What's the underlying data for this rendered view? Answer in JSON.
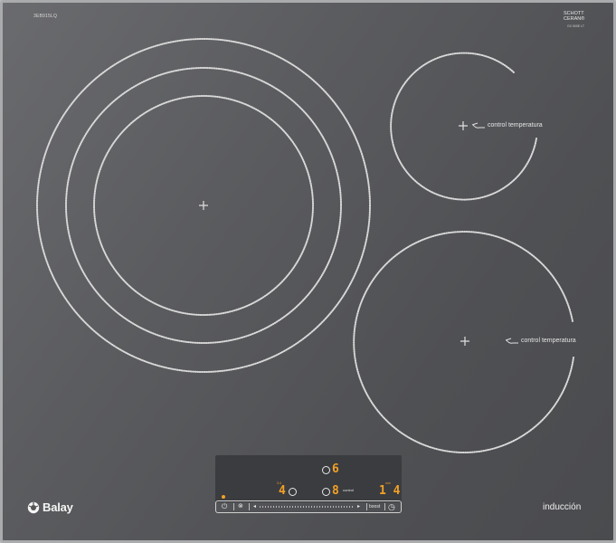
{
  "hob": {
    "model_code": "3EB915LQ",
    "certification": [
      "SCHOTT",
      "CERAN®"
    ],
    "certification_sub": "GX 500E LT"
  },
  "zones": {
    "right_top": {
      "label": "control temperatura"
    },
    "right_bottom": {
      "label": "control temperatura"
    }
  },
  "panel": {
    "zone_a_level": "6",
    "zone_b_level": "4",
    "zone_c_level": "8",
    "timer_value": "1 4",
    "zone_b_tiny": "3.4",
    "zone_c_tiny": "control",
    "timer_tiny": "min"
  },
  "control_bar": {
    "power_icon": "power-icon",
    "lock_icon": "child-lock-icon",
    "minus_symbol": "◂",
    "plus_symbol": "▸",
    "boost_label": "boost",
    "timer_icon": "clock-icon"
  },
  "brand": {
    "name": "Balay",
    "type_label": "inducción"
  },
  "colors": {
    "surface": "#545558",
    "display": "#f2a126",
    "frame": "#a9abad"
  }
}
